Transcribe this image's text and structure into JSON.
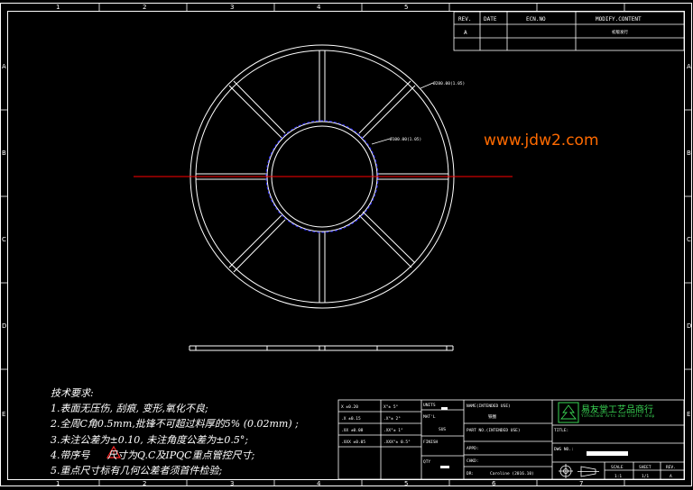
{
  "revision_table": {
    "headers": [
      "REV.",
      "DATE",
      "ECN.NO",
      "MODIFY.CONTENT"
    ],
    "row": {
      "rev": "A",
      "date": "",
      "ecn": "",
      "content": "初版发行"
    }
  },
  "border_zones": {
    "columns": [
      "1",
      "2",
      "3",
      "4",
      "5",
      "6",
      "7"
    ],
    "rows": [
      "A",
      "B",
      "C",
      "D",
      "E"
    ]
  },
  "callouts": {
    "outer": "Ø280.00(1.05)",
    "inner": "Ø100.00(1.05)"
  },
  "watermark": "www.jdw2.com",
  "notes": {
    "title": "技术要求:",
    "items": [
      "1.表面无压伤, 刮痕, 变形,氧化不良;",
      "2.全周C角0.5mm,批锋不可超过料厚的5% (0.02mm) ;",
      "3.未注公差为±0.10, 未注角度公差为±0.5°;",
      "4.带序号 尺寸为Q.C及IPQC重点管控尺寸;",
      "5.重点尺寸标有几何公差者须首件检验;"
    ]
  },
  "title_block": {
    "tolerances": [
      [
        "X ±0.20",
        "X°± 5°"
      ],
      [
        ".X ±0.15",
        ".X°± 2°"
      ],
      [
        ".XX ±0.08",
        ".XX°± 1°"
      ],
      [
        ".XXX ±0.05",
        ".XXX°± 0.5°"
      ]
    ],
    "units_label": "UNITS",
    "material_label": "MAT'L",
    "material_value": "SUS",
    "finish_label": "FINISH",
    "qty_label": "QTY",
    "name_label": "NAME(INTENDED USE)",
    "name_value": "铁圈",
    "part_no_label": "PART NO.(INTENDED USE)",
    "appd_label": "APPD:",
    "chkd_label": "CHKD:",
    "dr_label": "DR:",
    "dr_value": "Caroline (2016.10)",
    "company_name": "易友堂工艺品商行",
    "company_sub": "YiYouTanG Arts and crafts shop",
    "title_label": "TITLE:",
    "dwg_label": "DWG NO.:",
    "scale_label": "SCALE",
    "scale_value": "1:1",
    "sheet_label": "SHEET",
    "sheet_value": "1/1",
    "rev_label": "REV.",
    "rev_value": "A"
  },
  "colors": {
    "background": "#000000",
    "lines": "#ffffff",
    "center_line": "#ff0000",
    "hidden_circle": "#2a2aff",
    "watermark": "#ff6a00",
    "logo": "#39d353"
  }
}
